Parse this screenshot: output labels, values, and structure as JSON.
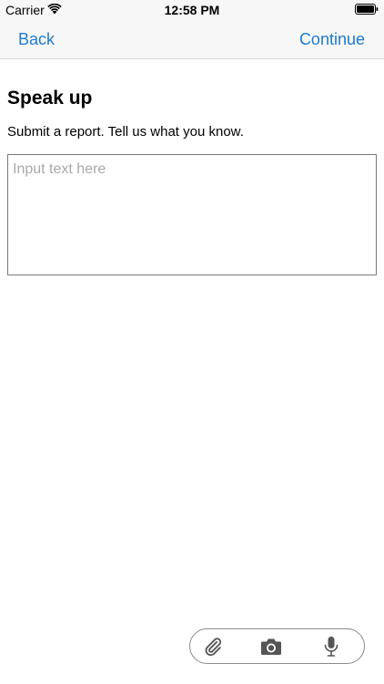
{
  "status_bar": {
    "carrier": "Carrier",
    "time": "12:58 PM",
    "wifi_icon": "wifi-icon",
    "battery_icon": "battery-icon"
  },
  "nav": {
    "back_label": "Back",
    "continue_label": "Continue"
  },
  "main": {
    "title": "Speak up",
    "subtitle": "Submit a report. Tell us what you know.",
    "input": {
      "value": "",
      "placeholder": "Input text here"
    }
  },
  "toolbar": {
    "icons": [
      "paperclip-icon",
      "camera-icon",
      "microphone-icon"
    ]
  },
  "colors": {
    "accent": "#1d7ccf",
    "icon": "#555555",
    "placeholder": "#a8a8a8",
    "bar_background": "#f7f7f7"
  }
}
